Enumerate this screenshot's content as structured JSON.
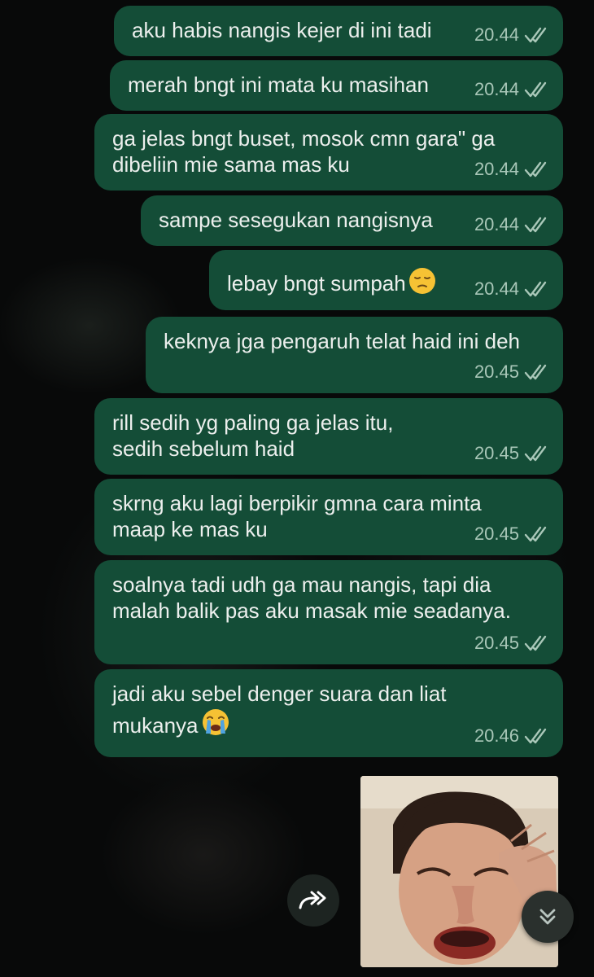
{
  "messages": [
    {
      "text": "aku habis nangis kejer di ini tadi",
      "time": "20.44"
    },
    {
      "text": "merah bngt ini mata ku masihan",
      "time": "20.44"
    },
    {
      "text": "ga jelas bngt buset, mosok cmn gara\" ga dibeliin mie sama mas ku",
      "time": "20.44"
    },
    {
      "text": "sampe sesegukan nangisnya",
      "time": "20.44"
    },
    {
      "text": "lebay bngt sumpah",
      "time": "20.44",
      "emoji": "pensive-face"
    },
    {
      "text": "keknya jga pengaruh telat haid ini deh",
      "time": "20.45"
    },
    {
      "text": "rill sedih yg paling ga jelas itu, sedih sebelum haid",
      "time": "20.45"
    },
    {
      "text": "skrng aku lagi berpikir gmna cara minta maap ke mas ku",
      "time": "20.45"
    },
    {
      "text": "soalnya tadi udh ga mau nangis, tapi dia malah balik pas aku masak mie seadanya.",
      "time": "20.45"
    },
    {
      "text": "jadi aku sebel denger suara dan liat mukanya",
      "time": "20.46",
      "emoji": "loudly-crying-face"
    }
  ],
  "image_message": {
    "subject": "crying-face-photo"
  },
  "status": {
    "read_icon": "double-check-icon"
  },
  "buttons": {
    "forward": "forward-icon",
    "scroll_down": "double-chevron-down-icon"
  },
  "colors": {
    "bubble": "#144d37",
    "text": "#ecefed",
    "meta": "#a9c7b8",
    "background": "#080909"
  }
}
